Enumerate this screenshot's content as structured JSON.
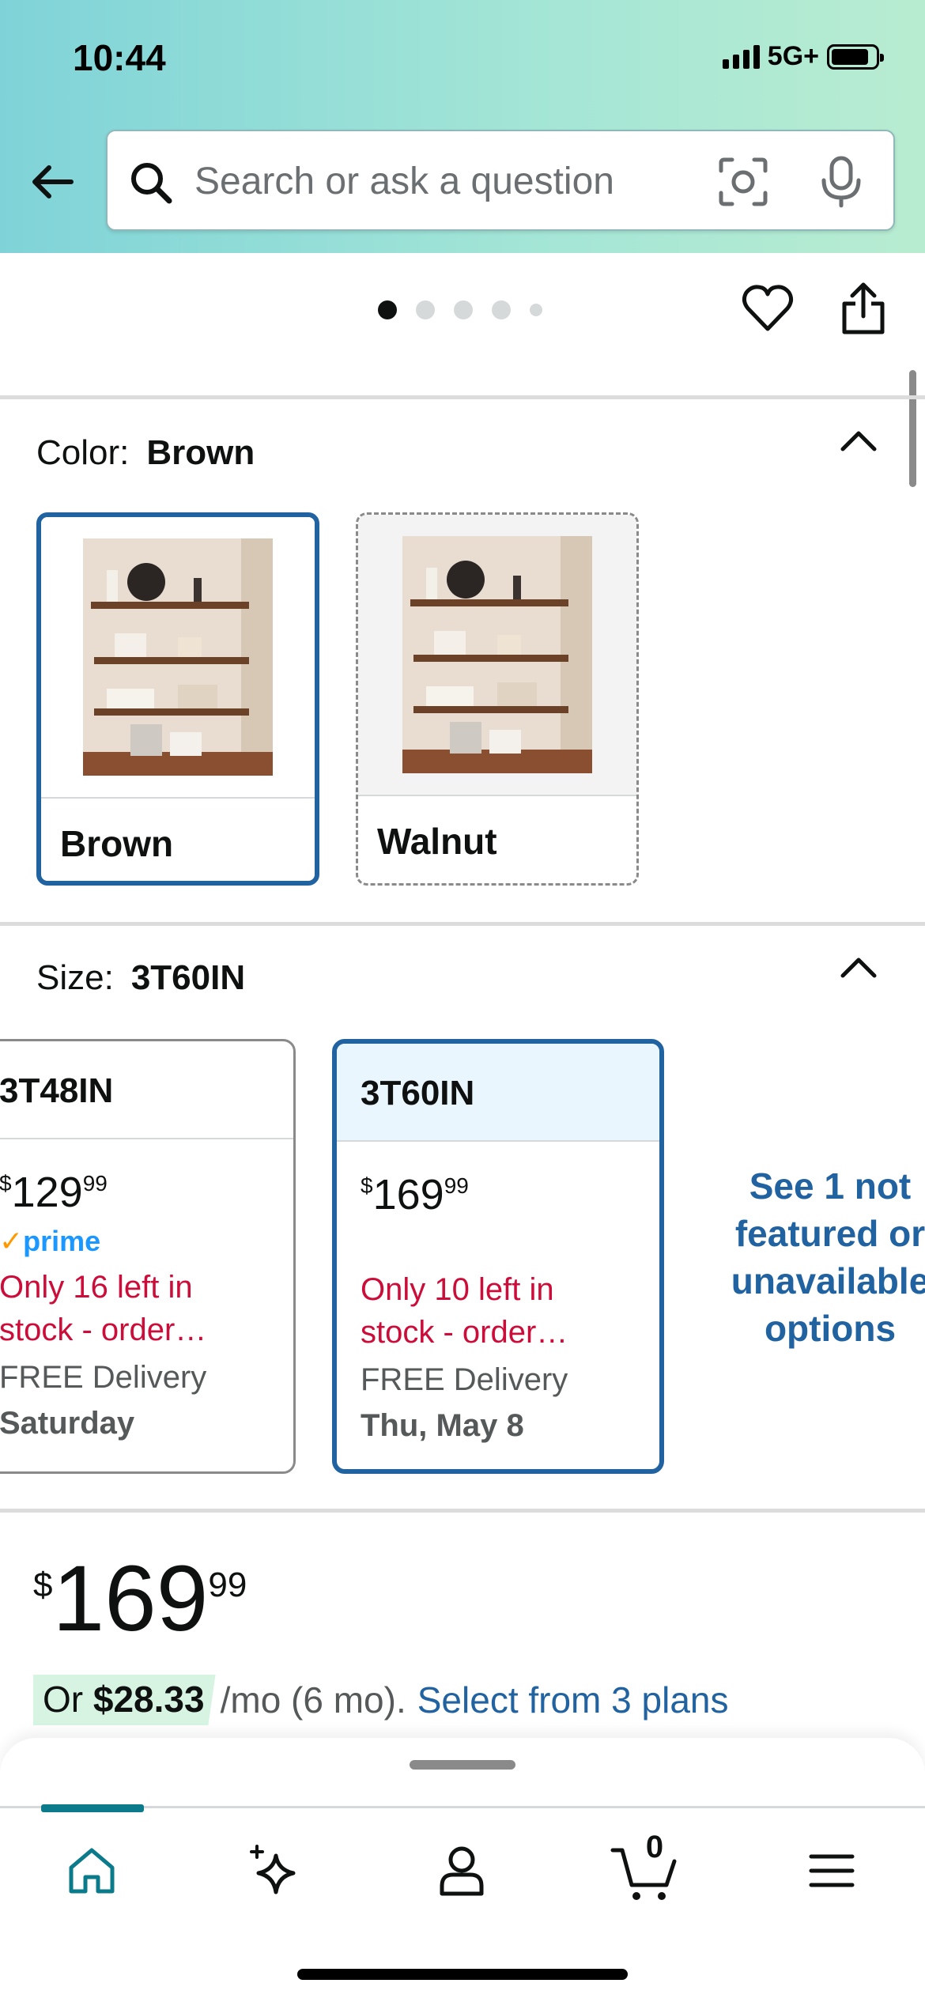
{
  "status_bar": {
    "time": "10:44",
    "network": "5G+"
  },
  "search": {
    "placeholder": "Search or ask a question"
  },
  "gallery": {
    "dot_count": 5,
    "active_dot": 0
  },
  "color": {
    "label": "Color:",
    "selected": "Brown",
    "options": [
      {
        "name": "Brown",
        "selected": true
      },
      {
        "name": "Walnut",
        "selected": false
      }
    ]
  },
  "size": {
    "label": "Size:",
    "selected": "3T60IN",
    "options": [
      {
        "name": "3T48IN",
        "price_whole": "129",
        "price_frac": "99",
        "currency": "$",
        "prime": "prime",
        "stock": "Only 16 left in stock - order…",
        "stock_line1": "Only 16 left in",
        "stock_line2": "stock - order…",
        "delivery": "FREE Delivery",
        "delivery_date": "Saturday"
      },
      {
        "name": "3T60IN",
        "price_whole": "169",
        "price_frac": "99",
        "currency": "$",
        "stock_line1": "Only 10 left in",
        "stock_line2": "stock - order…",
        "delivery": "FREE Delivery",
        "delivery_date": "Thu, May 8"
      }
    ],
    "see_more_lines": [
      "See 1 not",
      "featured or",
      "unavailable",
      "options"
    ]
  },
  "price": {
    "currency": "$",
    "whole": "169",
    "fraction": "99"
  },
  "plan": {
    "prefix": "Or",
    "amount": "$28.33",
    "term": "/mo (6 mo).",
    "link": "Select from 3 plans"
  },
  "cart": {
    "count": "0"
  },
  "colors": {
    "accent": "#2162a1",
    "stock_red": "#cc0c39",
    "nav_teal": "#0b7b8b",
    "plan_bg": "#d7f4e3"
  }
}
